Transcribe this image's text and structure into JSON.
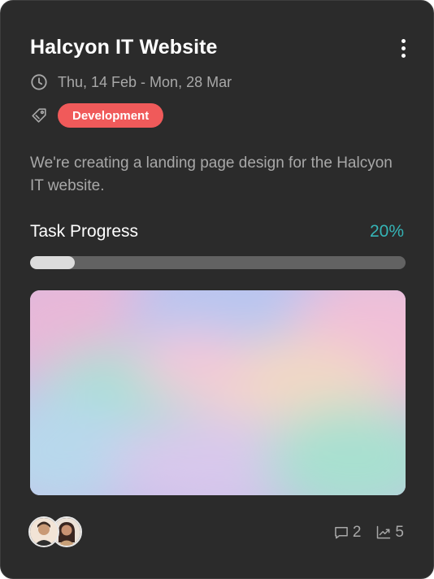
{
  "card": {
    "title": "Halcyon IT Website",
    "date_range": "Thu, 14 Feb - Mon, 28 Mar",
    "tag": "Development",
    "description": "We're creating a landing page design for the Halcyon IT website.",
    "progress": {
      "label": "Task Progress",
      "value_text": "20%",
      "fraction": 0.12
    },
    "members": [
      {
        "name": "member-1"
      },
      {
        "name": "member-2"
      }
    ],
    "stats": {
      "comments": "2",
      "activity": "5"
    }
  },
  "colors": {
    "card_bg": "#2b2b2b",
    "tag_bg": "#f05a5a",
    "accent_teal": "#35b4b6",
    "muted_text": "#a8a8a8"
  },
  "icons": [
    "more-vertical-icon",
    "clock-icon",
    "tag-icon",
    "comment-icon",
    "trending-up-icon"
  ]
}
